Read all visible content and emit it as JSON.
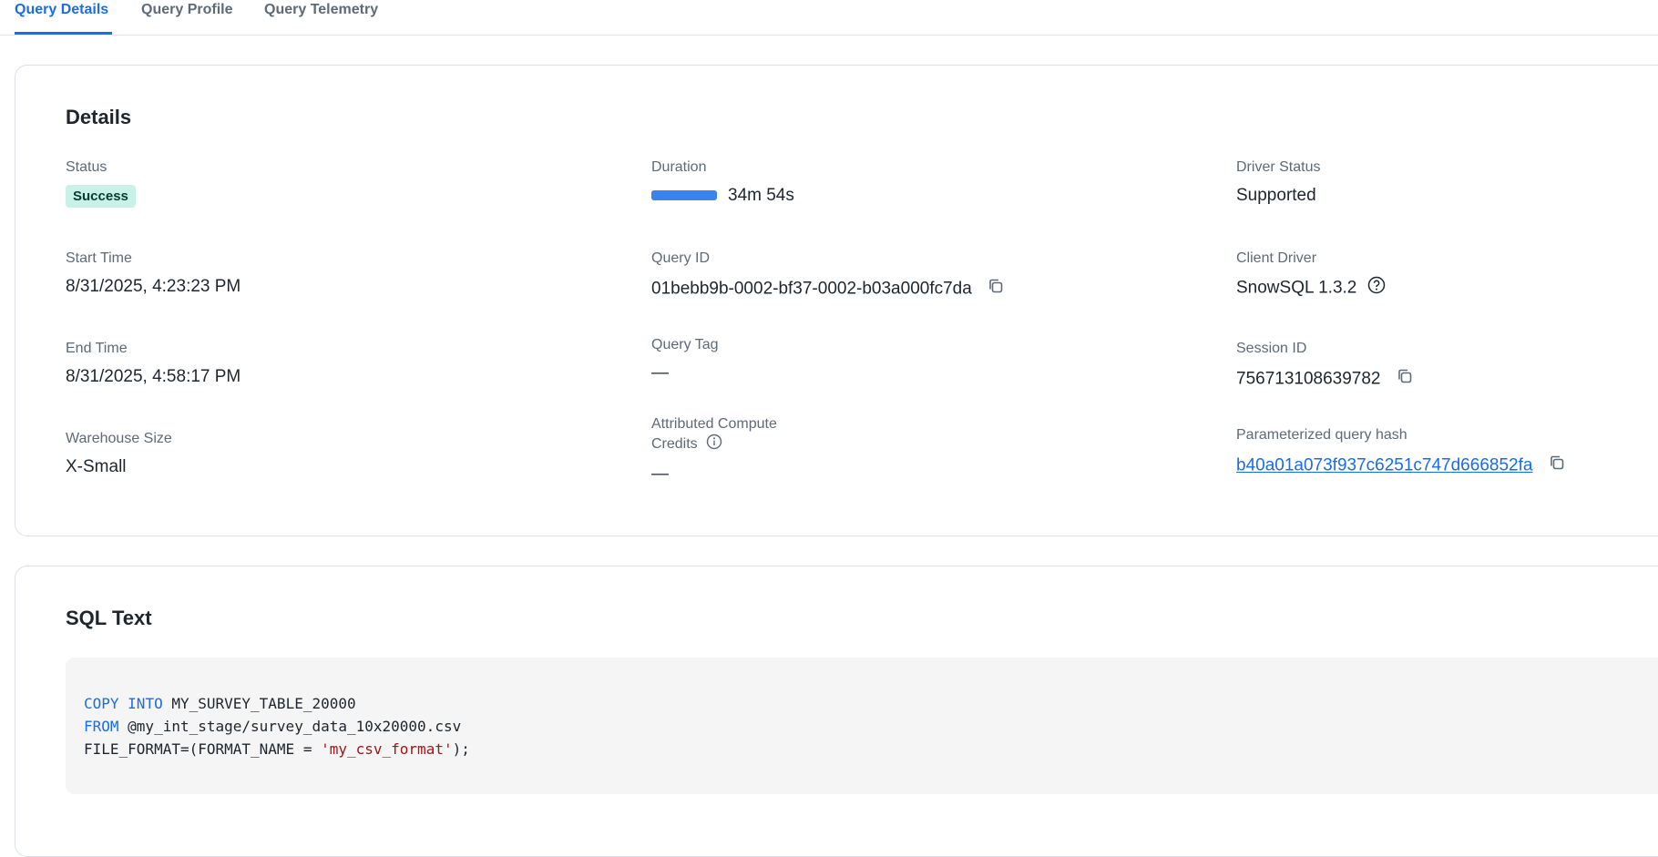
{
  "tabs": [
    {
      "label": "Query Details",
      "active": true
    },
    {
      "label": "Query Profile",
      "active": false
    },
    {
      "label": "Query Telemetry",
      "active": false
    }
  ],
  "details": {
    "title": "Details",
    "status": {
      "label": "Status",
      "value": "Success",
      "color": "#c8f2e8"
    },
    "duration": {
      "label": "Duration",
      "value": "34m 54s",
      "bar_fill_fraction": 1.0,
      "bar_color": "#3b82ea"
    },
    "driver_status": {
      "label": "Driver Status",
      "value": "Supported"
    },
    "start_time": {
      "label": "Start Time",
      "value": "8/31/2025, 4:23:23 PM"
    },
    "query_id": {
      "label": "Query ID",
      "value": "01bebb9b-0002-bf37-0002-b03a000fc7da",
      "icon": "copy-icon"
    },
    "client_driver": {
      "label": "Client Driver",
      "value": "SnowSQL 1.3.2",
      "icon": "help-icon"
    },
    "end_time": {
      "label": "End Time",
      "value": "8/31/2025, 4:58:17 PM"
    },
    "query_tag": {
      "label": "Query Tag",
      "value": "—"
    },
    "session_id": {
      "label": "Session ID",
      "value": "756713108639782",
      "icon": "copy-icon"
    },
    "warehouse_size": {
      "label": "Warehouse Size",
      "value": "X-Small"
    },
    "attributed_credits": {
      "label_line1": "Attributed Compute",
      "label_line2": "Credits",
      "value": "—",
      "icon": "info-icon"
    },
    "param_hash": {
      "label": "Parameterized query hash",
      "value": "b40a01a073f937c6251c747d666852fa",
      "icon": "copy-icon"
    }
  },
  "sql": {
    "title": "SQL Text",
    "line1": {
      "kw1": "COPY",
      "kw2": "INTO",
      "rest": " MY_SURVEY_TABLE_20000"
    },
    "line2": {
      "kw": "FROM",
      "rest": " @my_int_stage/survey_data_10x20000.csv"
    },
    "line3": {
      "pre": "FILE_FORMAT=(FORMAT_NAME = ",
      "str": "'my_csv_format'",
      "post": ");"
    }
  }
}
